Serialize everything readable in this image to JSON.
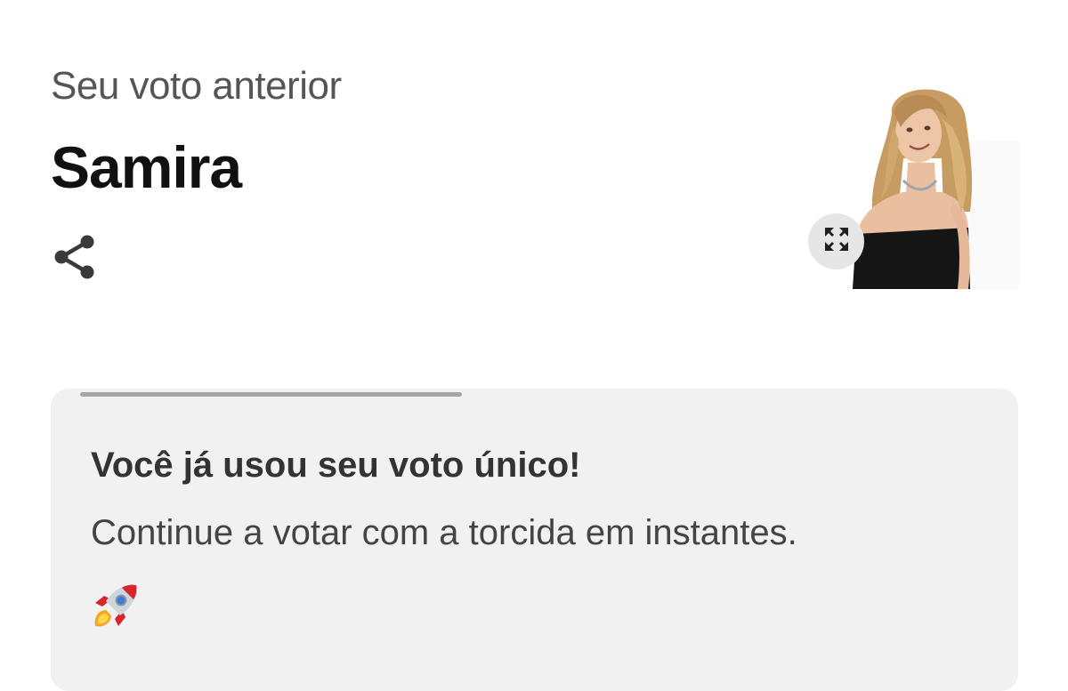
{
  "header": {
    "subtitle": "Seu voto anterior",
    "candidate_name": "Samira"
  },
  "icons": {
    "share": "share-icon",
    "expand": "expand-icon",
    "rocket": "rocket-emoji-icon"
  },
  "card": {
    "progress": 0.42,
    "title": "Você já usou seu voto único!",
    "message": "Continue a votar com a torcida em instantes."
  },
  "colors": {
    "text_primary": "#111111",
    "text_secondary": "#555555",
    "card_background": "#f1f1f1",
    "progress_fill": "#a6a6a6"
  }
}
